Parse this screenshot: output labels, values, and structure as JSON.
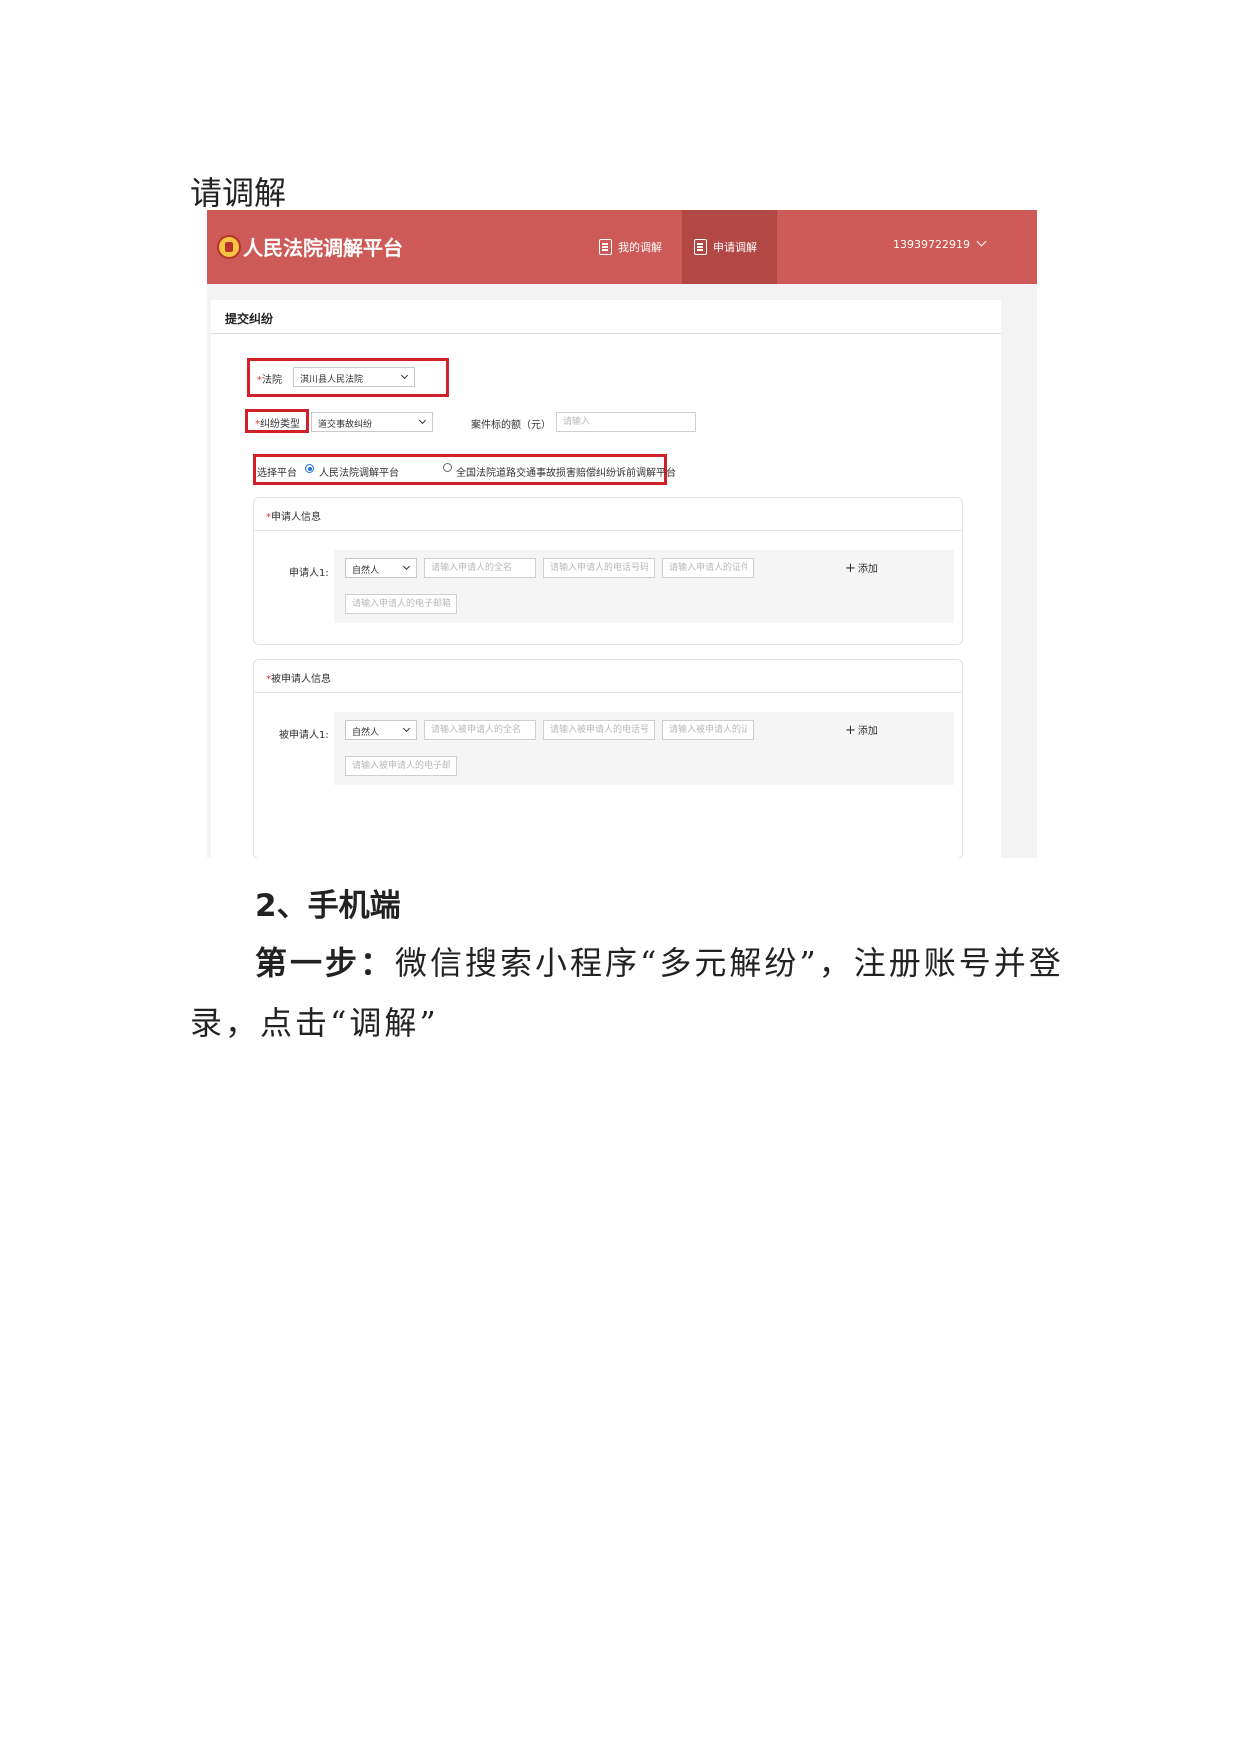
{
  "doc": {
    "heading": "请调解",
    "section2": "2、手机端",
    "step1_label": "第一步：",
    "step1_text": "微信搜索小程序“多元解纷”，注册账号并登",
    "step1_cont": "录，点击“调解”"
  },
  "app": {
    "brand": "人民法院调解平台",
    "nav": {
      "my_mediation": "我的调解",
      "apply_mediation": "申请调解"
    },
    "user": "13939722919",
    "icons": {
      "logo": "court-emblem-icon",
      "nav_doc": "document-icon",
      "nav_apply": "form-icon",
      "chevron": "chevron-down-icon"
    },
    "accent": "#cd5a56",
    "highlight": "#d0202a"
  },
  "form": {
    "title": "提交纠纷",
    "court": {
      "req": "*",
      "label": "法院",
      "value": "淇川县人民法院"
    },
    "type": {
      "req": "*",
      "label": "纠纷类型",
      "value": "道交事故纠纷"
    },
    "amount": {
      "label": "案件标的额（元）",
      "placeholder": "请输入"
    },
    "platform": {
      "label": "选择平台",
      "option1": "人民法院调解平台",
      "option2": "全国法院道路交通事故损害赔偿纠纷诉前调解平台",
      "selected": "option1"
    },
    "applicant": {
      "req": "*",
      "title": "申请人信息",
      "row_label": "申请人1:",
      "type_value": "自然人",
      "name_ph": "请输入申请人的全名",
      "phone_ph": "请输入申请人的电话号码",
      "id_ph": "请输入申请人的证件",
      "email_ph": "请输入申请人的电子邮箱",
      "add": "添加"
    },
    "respondent": {
      "req": "*",
      "title": "被申请人信息",
      "row_label": "被申请人1:",
      "type_value": "自然人",
      "name_ph": "请输入被申请人的全名",
      "phone_ph": "请输入被申请人的电话号码",
      "id_ph": "请输入被申请人的证件",
      "email_ph": "请输入被申请人的电子邮箱",
      "add": "添加"
    }
  }
}
